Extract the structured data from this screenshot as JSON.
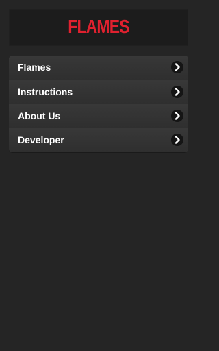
{
  "header": {
    "logo_text": "FLAMES"
  },
  "menu": {
    "items": [
      {
        "label": "Flames",
        "icon": "chevron-right-icon"
      },
      {
        "label": "Instructions",
        "icon": "chevron-right-icon"
      },
      {
        "label": "About Us",
        "icon": "chevron-right-icon"
      },
      {
        "label": "Developer",
        "icon": "chevron-right-icon"
      }
    ]
  },
  "colors": {
    "background": "#252525",
    "logo": "#e0212f",
    "menu_background": "#333333",
    "text": "#ffffff"
  }
}
